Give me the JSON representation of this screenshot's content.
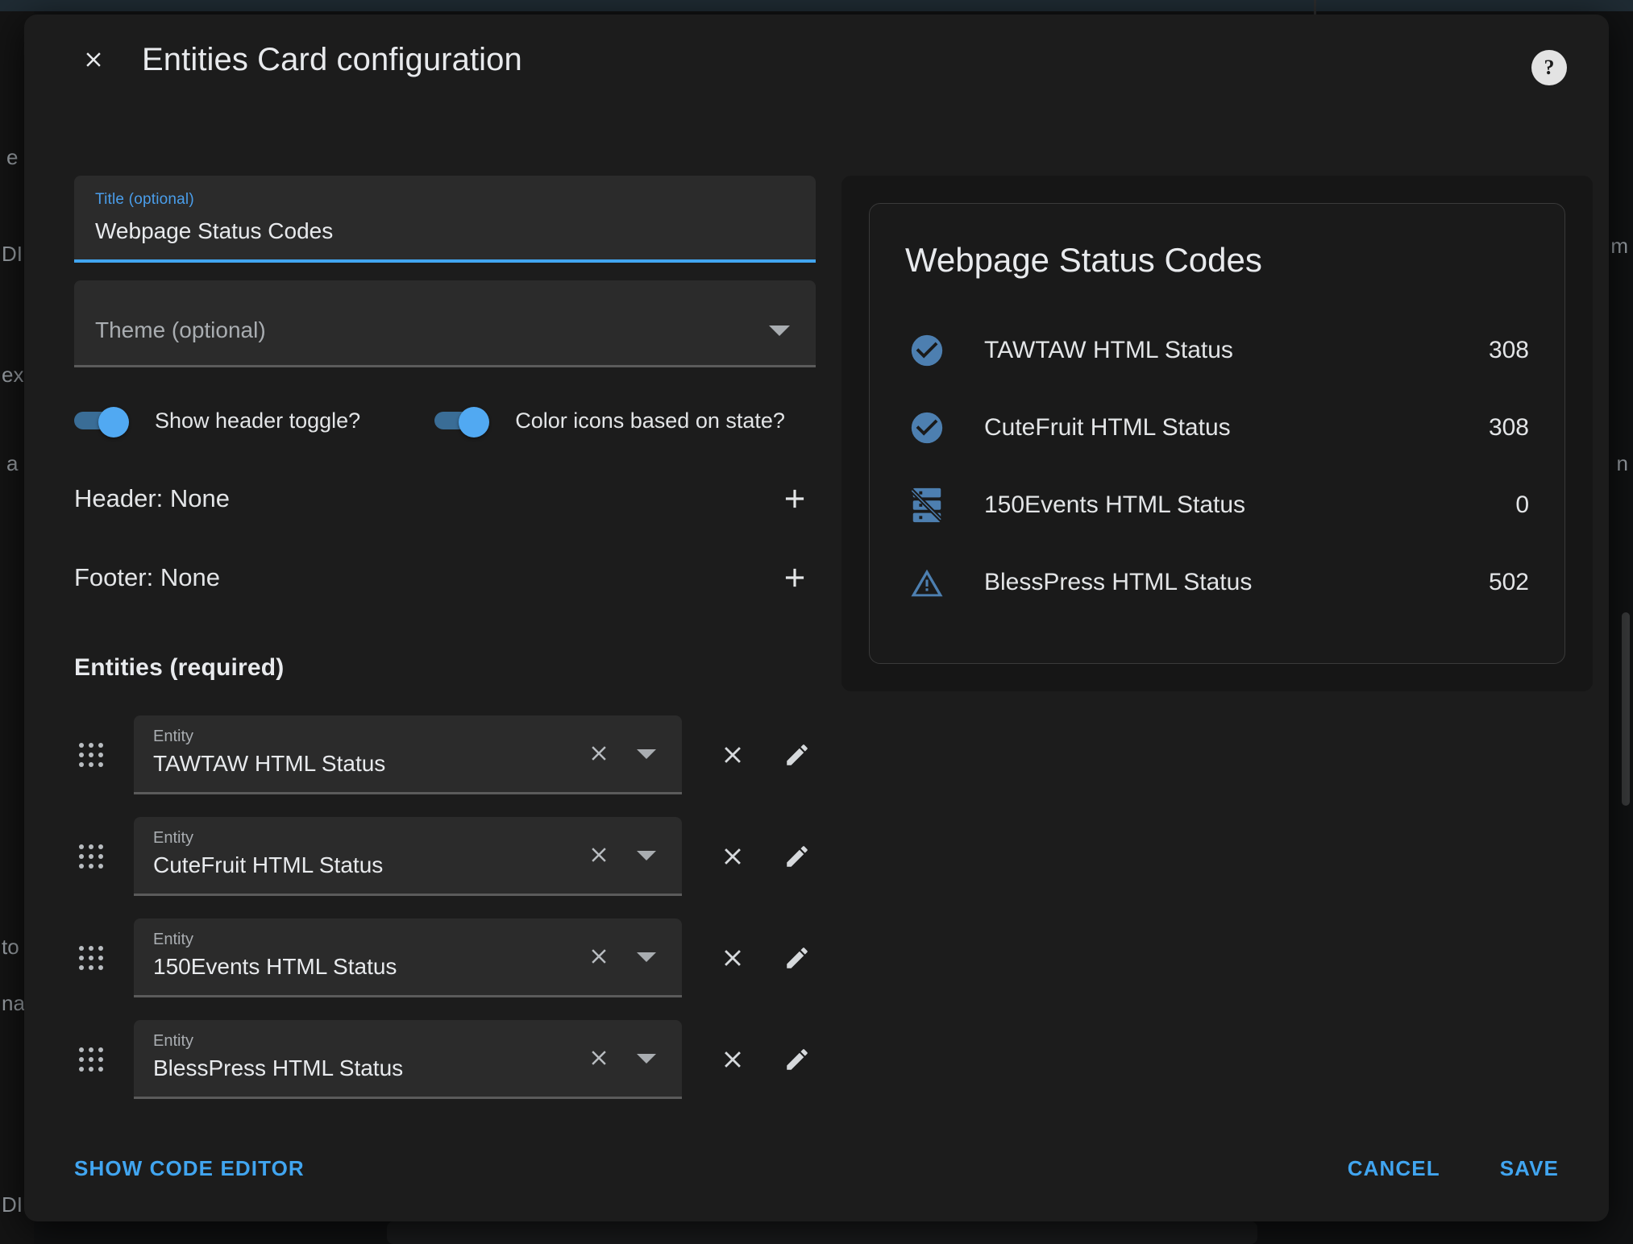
{
  "background": {
    "ghost_texts": [
      "e",
      "DI",
      "ex",
      "a",
      "to",
      "na",
      "DI",
      "m",
      "n"
    ],
    "accent": "#1f2b33"
  },
  "dialog": {
    "title": "Entities Card configuration",
    "close_icon": "close-icon",
    "help_icon": "help-icon",
    "help_label": "?"
  },
  "form": {
    "title_field": {
      "label": "Title (optional)",
      "value": "Webpage Status Codes",
      "focused": true
    },
    "theme_field": {
      "label": "Theme (optional)",
      "placeholder": "Theme (optional)",
      "value": ""
    },
    "toggles": [
      {
        "label": "Show header toggle?",
        "state": "on"
      },
      {
        "label": "Color icons based on state?",
        "state": "on"
      }
    ],
    "header_row": {
      "label": "Header: None",
      "add_icon": "plus-icon"
    },
    "footer_row": {
      "label": "Footer: None",
      "add_icon": "plus-icon"
    },
    "entities_section_title": "Entities (required)",
    "entity_field_label": "Entity",
    "entities": [
      {
        "value": "TAWTAW HTML Status"
      },
      {
        "value": "CuteFruit HTML Status"
      },
      {
        "value": "150Events HTML Status"
      },
      {
        "value": "BlessPress HTML Status"
      }
    ]
  },
  "preview": {
    "title": "Webpage Status Codes",
    "rows": [
      {
        "icon": "check-circle-icon",
        "name": "TAWTAW HTML Status",
        "value": "308",
        "icon_color": "#4d7fb0"
      },
      {
        "icon": "check-circle-icon",
        "name": "CuteFruit HTML Status",
        "value": "308",
        "icon_color": "#4d7fb0"
      },
      {
        "icon": "server-off-icon",
        "name": "150Events HTML Status",
        "value": "0",
        "icon_color": "#4d7fb0"
      },
      {
        "icon": "alert-triangle-icon",
        "name": "BlessPress HTML Status",
        "value": "502",
        "icon_color": "#4d7fb0"
      }
    ]
  },
  "footer": {
    "show_code_editor": "SHOW CODE EDITOR",
    "cancel": "CANCEL",
    "save": "SAVE"
  },
  "colors": {
    "accent_blue": "#41a5f0",
    "dialog_bg": "#1c1c1c",
    "field_bg": "#2b2b2b",
    "text_primary": "#e8eaed",
    "text_secondary": "#a9adb1",
    "icon_blue": "#4d7fb0"
  }
}
